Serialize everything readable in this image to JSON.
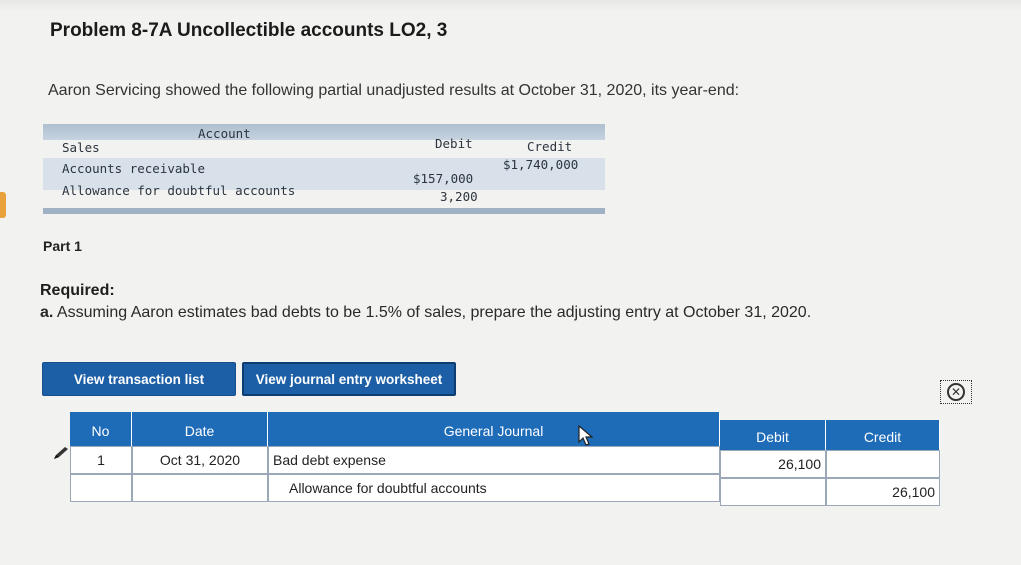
{
  "title": "Problem 8-7A Uncollectible accounts LO2, 3",
  "intro": "Aaron Servicing showed the following partial unadjusted results at October 31, 2020, its year-end:",
  "accounts_table": {
    "headers": {
      "account": "Account",
      "debit": "Debit",
      "credit": "Credit"
    },
    "rows": [
      {
        "account": "Sales",
        "debit": "",
        "credit": "$1,740,000"
      },
      {
        "account": "Accounts receivable",
        "debit": "$157,000",
        "credit": ""
      },
      {
        "account": "Allowance for doubtful accounts",
        "debit": "3,200",
        "credit": ""
      }
    ]
  },
  "part_label": "Part 1",
  "required_label": "Required:",
  "question_prefix": "a.",
  "question_text": " Assuming Aaron estimates bad debts to be 1.5% of sales, prepare the adjusting entry at October 31, 2020.",
  "buttons": {
    "transaction_list": "View transaction list",
    "journal_worksheet": "View journal entry worksheet"
  },
  "close_icon_glyph": "✕",
  "journal": {
    "headers": {
      "no": "No",
      "date": "Date",
      "general_journal": "General Journal",
      "debit": "Debit",
      "credit": "Credit"
    },
    "rows": [
      {
        "no": "1",
        "date": "Oct 31, 2020",
        "account": "Bad debt expense",
        "debit": "26,100",
        "credit": ""
      },
      {
        "no": "",
        "date": "",
        "account": "Allowance for doubtful accounts",
        "debit": "",
        "credit": "26,100"
      }
    ]
  },
  "colors": {
    "button_blue": "#1c5fa6",
    "header_blue": "#1e6bb8",
    "accent_orange": "#e9a23b"
  },
  "icons": [
    "pencil-icon",
    "close-circle-icon",
    "mouse-cursor-icon"
  ]
}
